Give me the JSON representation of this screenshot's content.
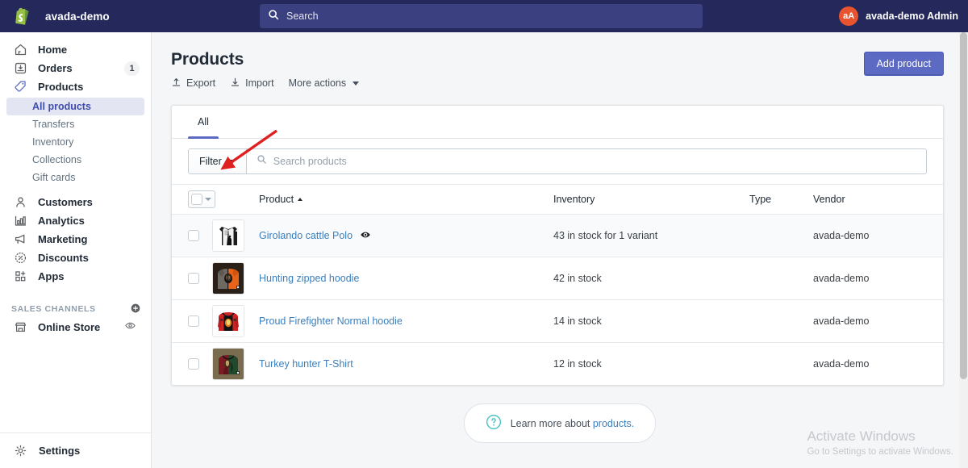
{
  "topbar": {
    "logo_icon": "shopify-bag-icon",
    "shop_name": "avada-demo",
    "search": {
      "icon": "search-icon",
      "placeholder": "Search",
      "value": ""
    },
    "user": {
      "avatar_initials": "aA",
      "name": "avada-demo Admin",
      "avatar_color": "#e8542f"
    }
  },
  "sidebar": {
    "items": [
      {
        "label": "Home",
        "icon": "home-icon",
        "badge": ""
      },
      {
        "label": "Orders",
        "icon": "orders-icon",
        "badge": "1"
      },
      {
        "label": "Products",
        "icon": "products-tag-icon",
        "badge": ""
      }
    ],
    "products_subitems": [
      {
        "label": "All products",
        "selected": true
      },
      {
        "label": "Transfers",
        "selected": false
      },
      {
        "label": "Inventory",
        "selected": false
      },
      {
        "label": "Collections",
        "selected": false
      },
      {
        "label": "Gift cards",
        "selected": false
      }
    ],
    "items2": [
      {
        "label": "Customers",
        "icon": "customers-icon"
      },
      {
        "label": "Analytics",
        "icon": "analytics-icon"
      },
      {
        "label": "Marketing",
        "icon": "marketing-megaphone-icon"
      },
      {
        "label": "Discounts",
        "icon": "discounts-tag-icon"
      },
      {
        "label": "Apps",
        "icon": "apps-grid-plus-icon"
      }
    ],
    "sales_channels": {
      "section_label": "SALES CHANNELS",
      "add_icon": "plus-circle-icon",
      "items": [
        {
          "label": "Online Store",
          "icon": "storefront-icon",
          "trailing_icon": "eye-icon"
        }
      ]
    },
    "settings": {
      "label": "Settings",
      "icon": "gear-icon"
    }
  },
  "page": {
    "title": "Products",
    "actions": [
      {
        "label": "Export",
        "icon": "export-upload-icon"
      },
      {
        "label": "Import",
        "icon": "import-download-icon"
      },
      {
        "label": "More actions",
        "icon": "chevron-down-icon"
      }
    ],
    "primary_button": "Add product"
  },
  "card": {
    "tabs": [
      {
        "label": "All",
        "active": true
      }
    ],
    "filter": {
      "button_label": "Filter",
      "caret_icon": "chevron-down-icon"
    },
    "search": {
      "icon": "search-icon",
      "placeholder": "Search products",
      "value": ""
    },
    "table": {
      "select_all": {
        "checkbox": "select-all-checkbox",
        "caret_icon": "chevron-down-icon"
      },
      "columns": [
        {
          "key": "product",
          "label": "Product",
          "sort": "asc"
        },
        {
          "key": "inventory",
          "label": "Inventory",
          "sort": ""
        },
        {
          "key": "type",
          "label": "Type",
          "sort": ""
        },
        {
          "key": "vendor",
          "label": "Vendor",
          "sort": ""
        }
      ],
      "rows": [
        {
          "name": "Girolando cattle Polo",
          "inventory": "43 in stock for 1 variant",
          "type": "",
          "vendor": "avada-demo",
          "badge_icon": "eye-preview-icon",
          "hovered": true,
          "thumb": "polo-shirt-black-white"
        },
        {
          "name": "Hunting zipped hoodie",
          "inventory": "42 in stock",
          "type": "",
          "vendor": "avada-demo",
          "badge_icon": "",
          "hovered": false,
          "thumb": "hoodie-orange-grey"
        },
        {
          "name": "Proud Firefighter Normal hoodie",
          "inventory": "14 in stock",
          "type": "",
          "vendor": "avada-demo",
          "badge_icon": "",
          "hovered": false,
          "thumb": "hoodie-red-firefighter"
        },
        {
          "name": "Turkey hunter T-Shirt",
          "inventory": "12 in stock",
          "type": "",
          "vendor": "avada-demo",
          "badge_icon": "",
          "hovered": false,
          "thumb": "tshirt-turkey-green"
        }
      ]
    }
  },
  "footer": {
    "icon": "question-circle-icon",
    "text": "Learn more about ",
    "link": "products.",
    "link_color": "#3a7fbf"
  },
  "watermark": {
    "line1": "Activate Windows",
    "line2": "Go to Settings to activate Windows."
  },
  "annotation": {
    "type": "arrow",
    "color": "#e02020",
    "points_at": "filter-button"
  },
  "colors": {
    "topbar_bg": "#24285b",
    "accent": "#5c6ac4",
    "page_bg": "#f4f6f8",
    "link": "#3a7fbf",
    "selected_nav_bg": "#e4e5f3"
  }
}
